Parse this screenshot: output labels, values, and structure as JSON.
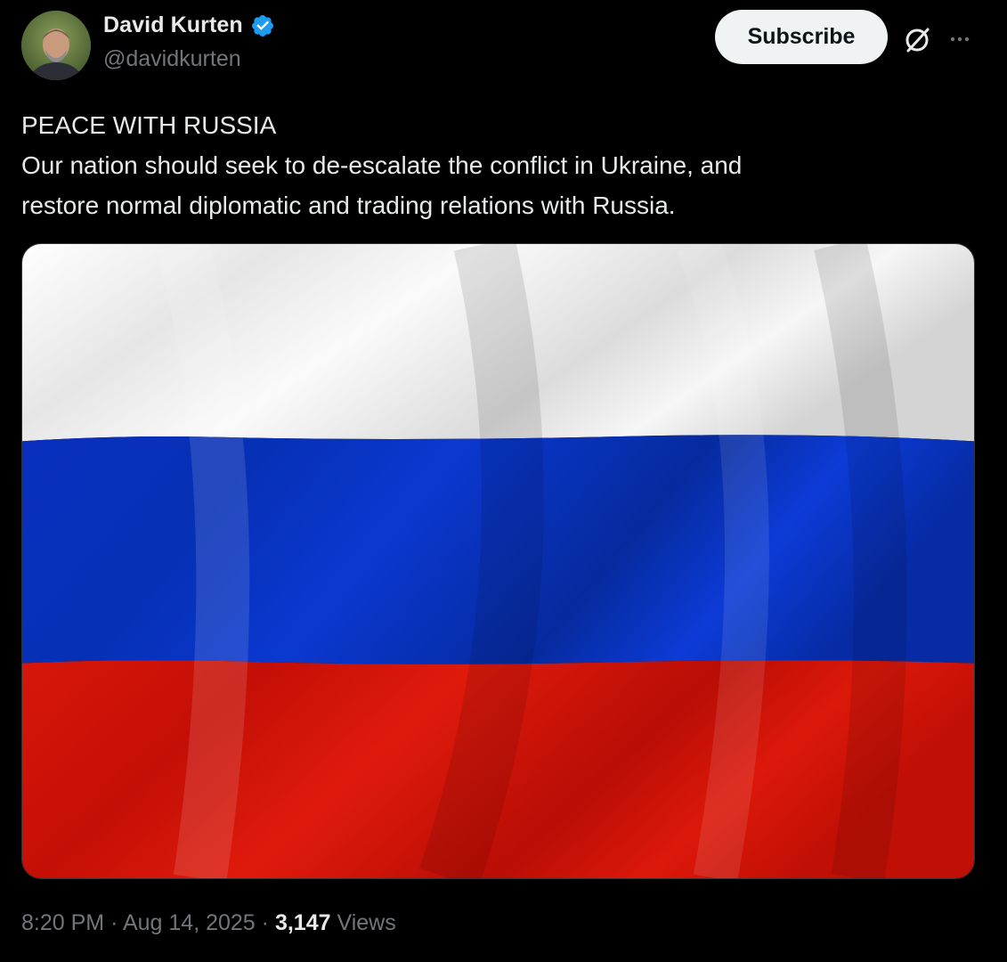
{
  "author": {
    "display_name": "David Kurten",
    "handle": "@davidkurten",
    "verified": true
  },
  "actions": {
    "subscribe_label": "Subscribe",
    "grok_icon": "grok-icon",
    "more_icon": "more-icon"
  },
  "post": {
    "text_lines": [
      "PEACE WITH RUSSIA",
      "Our nation should seek to de-escalate the conflict in Ukraine, and",
      "restore normal diplomatic and trading relations with Russia."
    ],
    "media": {
      "icon": "russian-flag-image",
      "stripe_colors": [
        "#f4f4f4",
        "#0b33c7",
        "#d01208"
      ]
    }
  },
  "meta": {
    "time": "8:20 PM",
    "separator": "·",
    "date": "Aug 14, 2025",
    "views_count": "3,147",
    "views_label": "Views"
  },
  "colors": {
    "background": "#000000",
    "text_primary": "#e7e9ea",
    "text_secondary": "#71767b",
    "verified_blue": "#1d9bf0",
    "button_bg": "#eff3f4"
  }
}
